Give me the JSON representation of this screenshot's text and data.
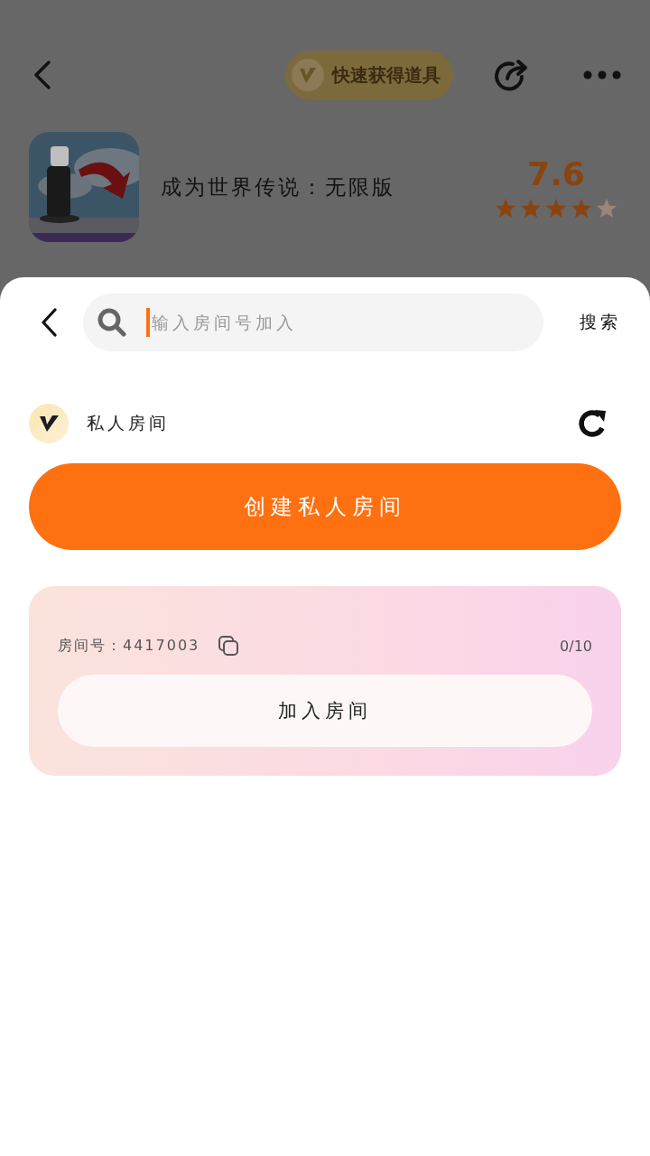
{
  "header": {
    "badge": "快速获得道具"
  },
  "app": {
    "title": "成为世界传说：无限版",
    "rating": "7.6",
    "stars": 4
  },
  "sheet": {
    "search": {
      "placeholder": "输入房间号加入",
      "button": "搜索"
    },
    "section": {
      "title": "私人房间"
    },
    "create_button": "创建私人房间",
    "room": {
      "label": "房间号：4417003",
      "count": "0/10",
      "join_button": "加入房间"
    }
  }
}
